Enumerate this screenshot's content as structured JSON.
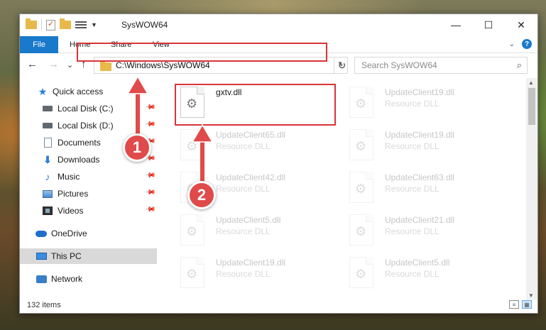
{
  "window": {
    "title": "SysWOW64",
    "controls": {
      "minimize": "—",
      "maximize": "☐",
      "close": "✕"
    }
  },
  "ribbon": {
    "file": "File",
    "tabs": [
      "Home",
      "Share",
      "View"
    ],
    "help": "?"
  },
  "nav": {
    "back": "←",
    "forward": "→",
    "recent": "⌄",
    "up": "↑",
    "address": "C:\\Windows\\SysWOW64",
    "refresh": "↻",
    "search_placeholder": "Search SysWOW64",
    "search_icon": "⌕"
  },
  "sidebar": {
    "items": [
      {
        "label": "Quick access",
        "icon": "star-icon"
      },
      {
        "label": "Local Disk (C:)",
        "icon": "disk-icon",
        "pinned": true
      },
      {
        "label": "Local Disk (D:)",
        "icon": "disk-icon",
        "pinned": true
      },
      {
        "label": "Documents",
        "icon": "document-icon",
        "pinned": true
      },
      {
        "label": "Downloads",
        "icon": "download-icon",
        "pinned": true
      },
      {
        "label": "Music",
        "icon": "music-icon",
        "pinned": true
      },
      {
        "label": "Pictures",
        "icon": "pictures-icon",
        "pinned": true
      },
      {
        "label": "Videos",
        "icon": "videos-icon",
        "pinned": true
      },
      {
        "label": "OneDrive",
        "icon": "onedrive-icon"
      },
      {
        "label": "This PC",
        "icon": "pc-icon",
        "selected": true
      },
      {
        "label": "Network",
        "icon": "network-icon"
      }
    ]
  },
  "files": [
    {
      "name": "gxtv.dll",
      "type": ""
    },
    {
      "name": "UpdateClient19.dll",
      "type": "Resource DLL"
    },
    {
      "name": "UpdateClient65.dll",
      "type": "Resource DLL"
    },
    {
      "name": "UpdateClient19.dll",
      "type": "Resource DLL"
    },
    {
      "name": "UpdateClient42.dll",
      "type": "Resource DLL"
    },
    {
      "name": "UpdateClient63.dll",
      "type": "Resource DLL"
    },
    {
      "name": "UpdateClient5.dll",
      "type": "Resource DLL"
    },
    {
      "name": "UpdateClient21.dll",
      "type": "Resource DLL"
    },
    {
      "name": "UpdateClient19.dll",
      "type": "Resource DLL"
    },
    {
      "name": "UpdateClient5.dll",
      "type": "Resource DLL"
    }
  ],
  "status": {
    "count": "132 items"
  },
  "annotations": {
    "step1": "1",
    "step2": "2"
  },
  "colors": {
    "accent": "#1979ca",
    "highlight": "#d9333a",
    "badge": "#e04a4a"
  }
}
